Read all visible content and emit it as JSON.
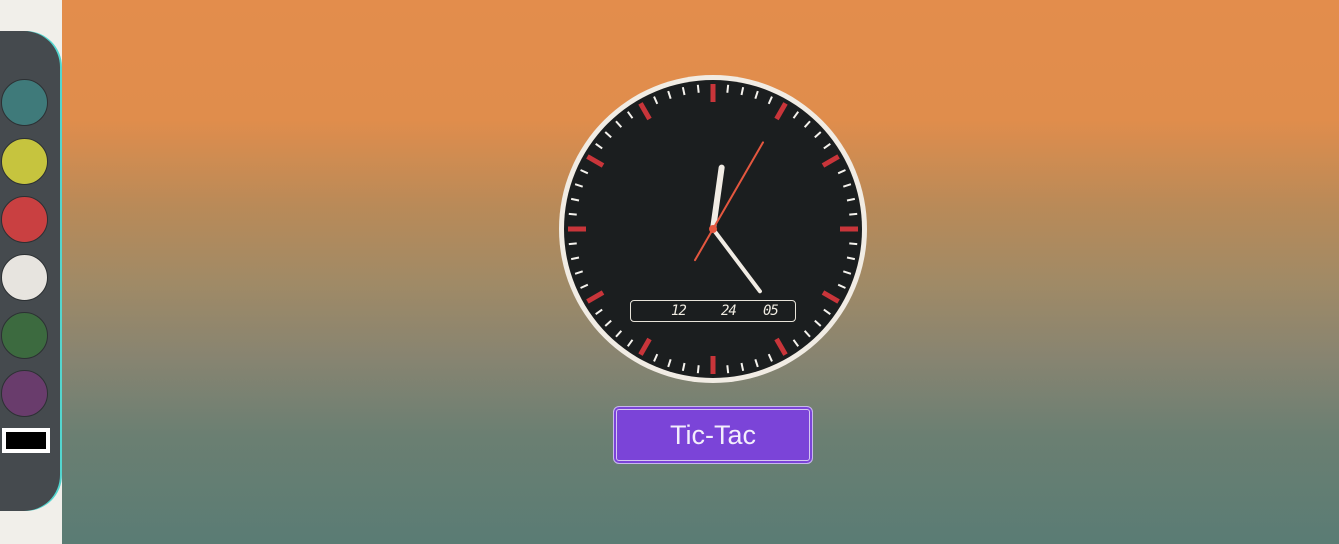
{
  "palette": {
    "swatches": [
      {
        "name": "teal",
        "color": "#3f7a7a"
      },
      {
        "name": "yellow",
        "color": "#c6c43e"
      },
      {
        "name": "red",
        "color": "#c94041"
      },
      {
        "name": "white",
        "color": "#e7e4df"
      },
      {
        "name": "green",
        "color": "#3c6a3f"
      },
      {
        "name": "purple",
        "color": "#693c6c"
      }
    ],
    "selected_color": "#000000",
    "accent": "#53d6cf"
  },
  "clock": {
    "face_color": "#1b1e1f",
    "rim_color": "#f1ece4",
    "hour_marker_color": "#c9353a",
    "minute_tick_color": "#f5f3ee",
    "second_hand_color": "#e4573f",
    "time": {
      "hours": 12,
      "minutes": 24,
      "seconds": 5
    },
    "digital": {
      "hours": "12",
      "minutes": "24",
      "seconds": "05"
    }
  },
  "button": {
    "label": "Tic-Tac",
    "color": "#7b44d8"
  }
}
